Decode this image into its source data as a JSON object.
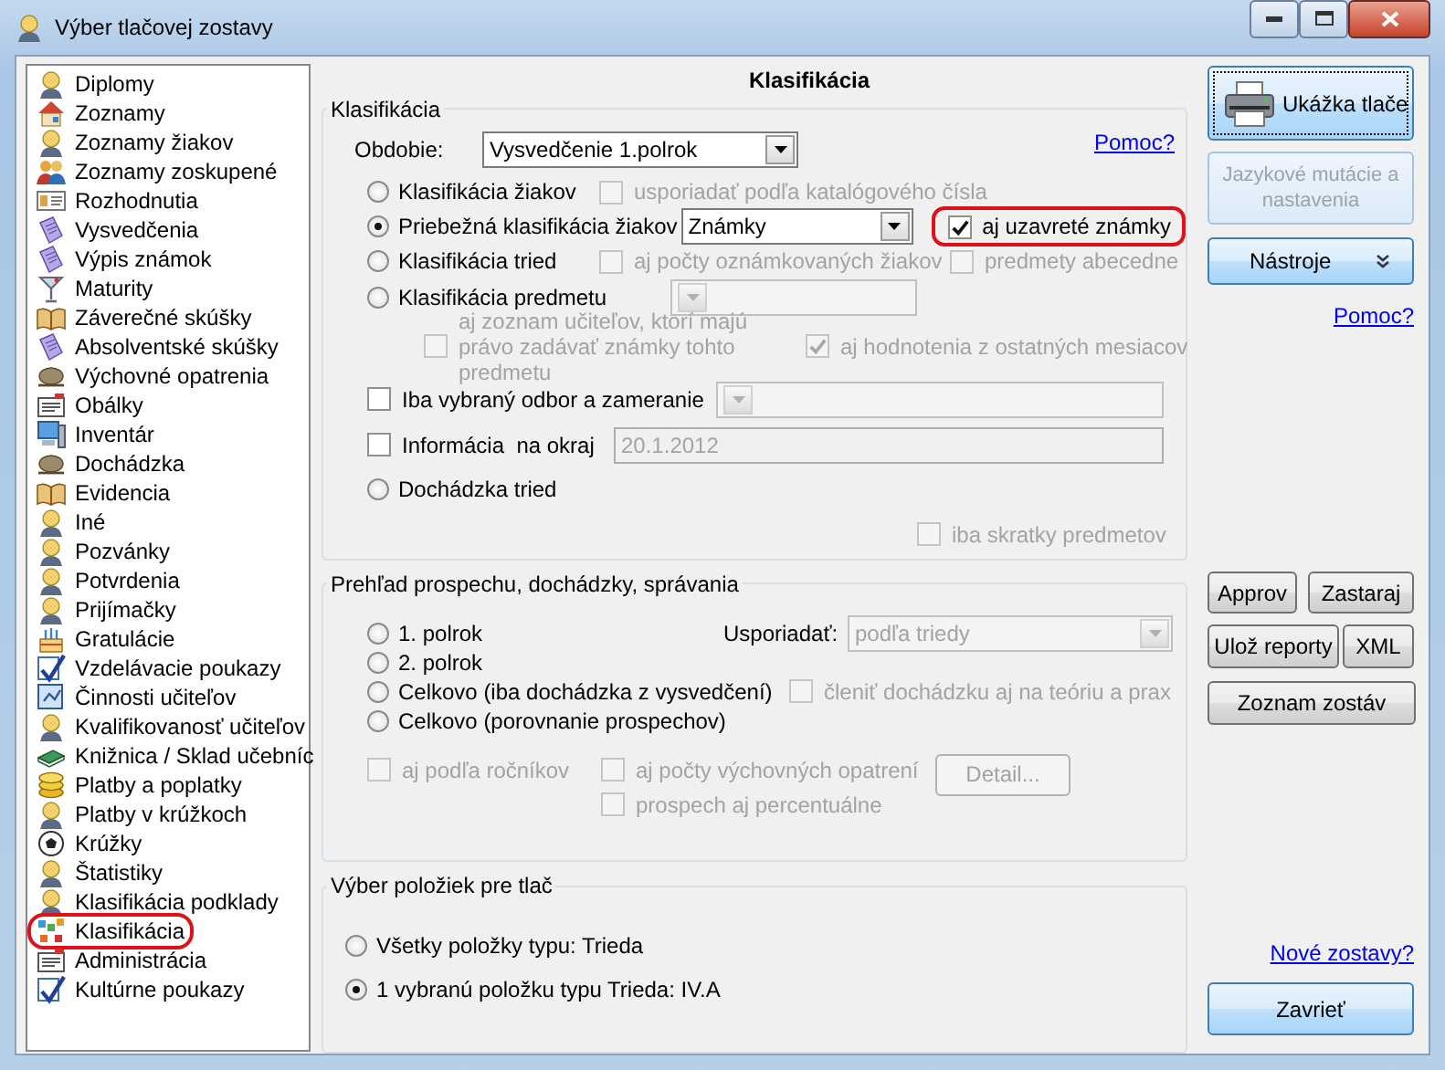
{
  "window": {
    "title": "Výber tlačovej zostavy"
  },
  "sidebar": {
    "items": [
      {
        "label": "Diplomy",
        "highlighted": false
      },
      {
        "label": "Zoznamy",
        "highlighted": false
      },
      {
        "label": "Zoznamy žiakov",
        "highlighted": false
      },
      {
        "label": "Zoznamy zoskupené",
        "highlighted": false
      },
      {
        "label": "Rozhodnutia",
        "highlighted": false
      },
      {
        "label": "Vysvedčenia",
        "highlighted": false
      },
      {
        "label": "Výpis známok",
        "highlighted": false
      },
      {
        "label": "Maturity",
        "highlighted": false
      },
      {
        "label": "Záverečné skúšky",
        "highlighted": false
      },
      {
        "label": "Absolventské skúšky",
        "highlighted": false
      },
      {
        "label": "Výchovné opatrenia",
        "highlighted": false
      },
      {
        "label": "Obálky",
        "highlighted": false
      },
      {
        "label": "Inventár",
        "highlighted": false
      },
      {
        "label": "Dochádzka",
        "highlighted": false
      },
      {
        "label": "Evidencia",
        "highlighted": false
      },
      {
        "label": "Iné",
        "highlighted": false
      },
      {
        "label": "Pozvánky",
        "highlighted": false
      },
      {
        "label": "Potvrdenia",
        "highlighted": false
      },
      {
        "label": "Prijímačky",
        "highlighted": false
      },
      {
        "label": "Gratulácie",
        "highlighted": false
      },
      {
        "label": "Vzdelávacie poukazy",
        "highlighted": false
      },
      {
        "label": "Činnosti učiteľov",
        "highlighted": false
      },
      {
        "label": "Kvalifikovanosť učiteľov",
        "highlighted": false
      },
      {
        "label": "Knižnica / Sklad učebníc",
        "highlighted": false
      },
      {
        "label": "Platby a poplatky",
        "highlighted": false
      },
      {
        "label": "Platby v krúžkoch",
        "highlighted": false
      },
      {
        "label": "Krúžky",
        "highlighted": false
      },
      {
        "label": "Štatistiky",
        "highlighted": false
      },
      {
        "label": "Klasifikácia podklady",
        "highlighted": false
      },
      {
        "label": "Klasifikácia",
        "highlighted": true
      },
      {
        "label": "Administrácia",
        "highlighted": false
      },
      {
        "label": "Kultúrne poukazy",
        "highlighted": false
      }
    ]
  },
  "panel": {
    "title": "Klasifikácia"
  },
  "classification": {
    "legend": "Klasifikácia",
    "period_label": "Obdobie:",
    "period_value": "Vysvedčenie 1.polrok",
    "help_link": "Pomoc?",
    "students": {
      "label": "Klasifikácia žiakov",
      "selected": false
    },
    "sort_by_number": {
      "label": "usporiadať podľa katalógového čísla",
      "checked": false,
      "disabled": true
    },
    "ongoing": {
      "label": "Priebežná klasifikácia žiakov",
      "selected": true
    },
    "ongoing_mode": {
      "value": "Známky",
      "disabled": false
    },
    "closed_grades": {
      "label": "aj uzavreté známky",
      "checked": true,
      "disabled": false,
      "highlighted": true
    },
    "classes": {
      "label": "Klasifikácia tried",
      "selected": false
    },
    "graded_counts": {
      "label": "aj počty oznámkovaných žiakov",
      "checked": false,
      "disabled": true
    },
    "subjects_alphabetical": {
      "label": "predmety abecedne",
      "checked": false,
      "disabled": true
    },
    "subject": {
      "label": "Klasifikácia predmetu",
      "selected": false
    },
    "subject_select": {
      "disabled": true
    },
    "teachers_list": {
      "label": "aj zoznam učiteľov, ktorí majú právo zadávať známky tohto predmetu",
      "checked": false,
      "disabled": true
    },
    "other_months": {
      "label": "aj hodnotenia z ostatných mesiacov",
      "checked": true,
      "disabled": true
    },
    "branch_only": {
      "label": "Iba vybraný odbor a zameranie",
      "checked": false,
      "disabled": false
    },
    "branch_select": {
      "disabled": true
    },
    "margin_info": {
      "label": "Informácia  na okraj",
      "checked": false,
      "disabled": false
    },
    "margin_text": {
      "value": "20.1.2012",
      "disabled": true
    },
    "class_attendance": {
      "label": "Dochádzka tried",
      "selected": false
    },
    "abbreviations": {
      "label": "iba skratky predmetov",
      "checked": false,
      "disabled": true
    }
  },
  "overview": {
    "legend": "Prehľad prospechu, dochádzky, správania",
    "first_half": {
      "label": "1. polrok",
      "selected": false
    },
    "second_half": {
      "label": "2. polrok",
      "selected": false
    },
    "total_attendance": {
      "label": "Celkovo (iba dochádzka z vysvedčení)",
      "selected": false
    },
    "total_comparison": {
      "label": "Celkovo (porovnanie prospechov)",
      "selected": false
    },
    "sort_label": "Usporiadať:",
    "sort_select": {
      "value": "podľa triedy",
      "disabled": true
    },
    "split_attendance": {
      "label": "členiť dochádzku aj na teóriu a prax",
      "checked": false,
      "disabled": true
    },
    "by_year": {
      "label": "aj podľa ročníkov",
      "checked": false,
      "disabled": true
    },
    "measure_counts": {
      "label": "aj počty výchovných opatrení",
      "checked": false,
      "disabled": true
    },
    "percent": {
      "label": "prospech aj percentuálne",
      "checked": false,
      "disabled": true
    },
    "detail_button": {
      "label": "Detail...",
      "disabled": true
    }
  },
  "items_selection": {
    "legend": "Výber položiek pre tlač",
    "options": [
      {
        "label": "Všetky položky typu: Trieda",
        "selected": false
      },
      {
        "label": "1 vybranú položku typu Trieda: IV.A",
        "selected": true
      }
    ]
  },
  "actions": {
    "print_preview": {
      "label": "Ukážka tlače"
    },
    "language": {
      "label": "Jazykové mutácie a nastavenia",
      "disabled": true
    },
    "tools": {
      "label": "Nástroje"
    },
    "help_link": "Pomoc?",
    "approv": {
      "label": "Approv"
    },
    "obsolete": {
      "label": "Zastaraj"
    },
    "save_reports": {
      "label": "Ulož reporty"
    },
    "xml": {
      "label": "XML"
    },
    "report_list": {
      "label": "Zoznam zostáv"
    },
    "new_reports_link": "Nové zostavy?",
    "close": {
      "label": "Zavrieť"
    }
  }
}
